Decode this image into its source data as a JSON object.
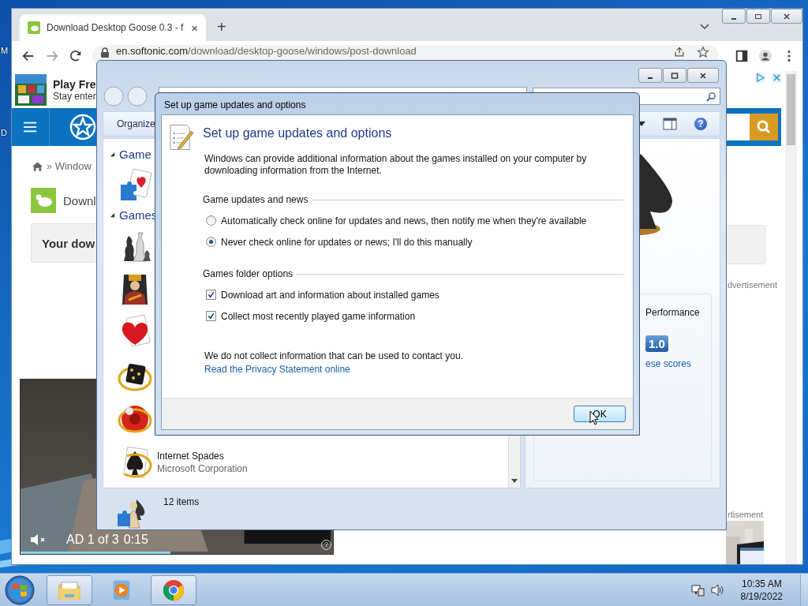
{
  "desktop": {
    "icon_labels": [
      "M",
      "D"
    ]
  },
  "browser": {
    "tab": {
      "title": "Download Desktop Goose 0.3 - f",
      "close": "×"
    },
    "new_tab": "+",
    "address": {
      "host": "en.softonic.com",
      "path": "/download/desktop-goose/windows/post-download"
    },
    "ad_banner": {
      "title": "Play Fre",
      "subtitle": "Stay enter"
    },
    "breadcrumb": {
      "separator": "»",
      "current": "Window"
    },
    "app_title": "Downl",
    "download_notice": "Your dow",
    "ad_labels": [
      "dvertisement",
      "rtisement"
    ],
    "video_ad": {
      "counter": "AD 1 of 3",
      "time": "0:15",
      "help": "?",
      "progress": {
        "level": 0.48
      }
    }
  },
  "games_explorer": {
    "toolbar": {
      "organize": "Organize",
      "help": "?"
    },
    "groups": [
      {
        "title": "Game",
        "expanded": true
      },
      {
        "title": "Games",
        "expanded": true
      }
    ],
    "visible_game": {
      "name": "Internet Spades",
      "publisher": "Microsoft Corporation"
    },
    "details": {
      "rating_label": "Performance",
      "score": "1.0",
      "link": "ese scores"
    },
    "status": "12 items"
  },
  "dialog": {
    "title": "Set up game updates and options",
    "heading": "Set up game updates and options",
    "description": "Windows can provide additional information about the games installed on your computer by downloading information from the Internet.",
    "sections": [
      {
        "title": "Game updates and news",
        "options": [
          {
            "kind": "radio",
            "label": "Automatically check online for updates and news, then notify me when they're available",
            "selected": false
          },
          {
            "kind": "radio",
            "label": "Never check online for updates or news; I'll do this manually",
            "selected": true
          }
        ]
      },
      {
        "title": "Games folder options",
        "options": [
          {
            "kind": "checkbox",
            "label": "Download art and information about installed games",
            "checked": true
          },
          {
            "kind": "checkbox",
            "label": "Collect most recently played game information",
            "checked": true
          }
        ]
      }
    ],
    "note": "We do not collect information that can be used to contact you.",
    "link": "Read the Privacy Statement online",
    "ok": "OK"
  },
  "taskbar": {
    "apps": [
      {
        "running": true
      },
      {
        "running": false
      },
      {
        "running": true
      }
    ],
    "time": "10:35 AM",
    "date": "8/19/2022"
  }
}
